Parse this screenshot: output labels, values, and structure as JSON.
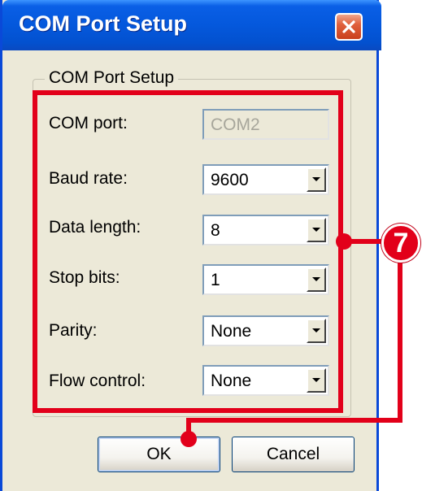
{
  "window": {
    "title": "COM Port Setup"
  },
  "group": {
    "label": "COM Port Setup"
  },
  "fields": {
    "com_port": {
      "label": "COM port:",
      "value": "COM2",
      "disabled": true
    },
    "baud_rate": {
      "label": "Baud rate:",
      "value": "9600"
    },
    "data_length": {
      "label": "Data length:",
      "value": "8"
    },
    "stop_bits": {
      "label": "Stop bits:",
      "value": "1"
    },
    "parity": {
      "label": "Parity:",
      "value": "None"
    },
    "flow_control": {
      "label": "Flow control:",
      "value": "None"
    }
  },
  "buttons": {
    "ok_label": "OK",
    "cancel_label": "Cancel"
  },
  "annotation": {
    "badge_number": "7",
    "color": "#e2001a"
  },
  "colors": {
    "titlebar": "#0458dc",
    "window_bg": "#ece9d8",
    "close_button": "#e0603c"
  }
}
